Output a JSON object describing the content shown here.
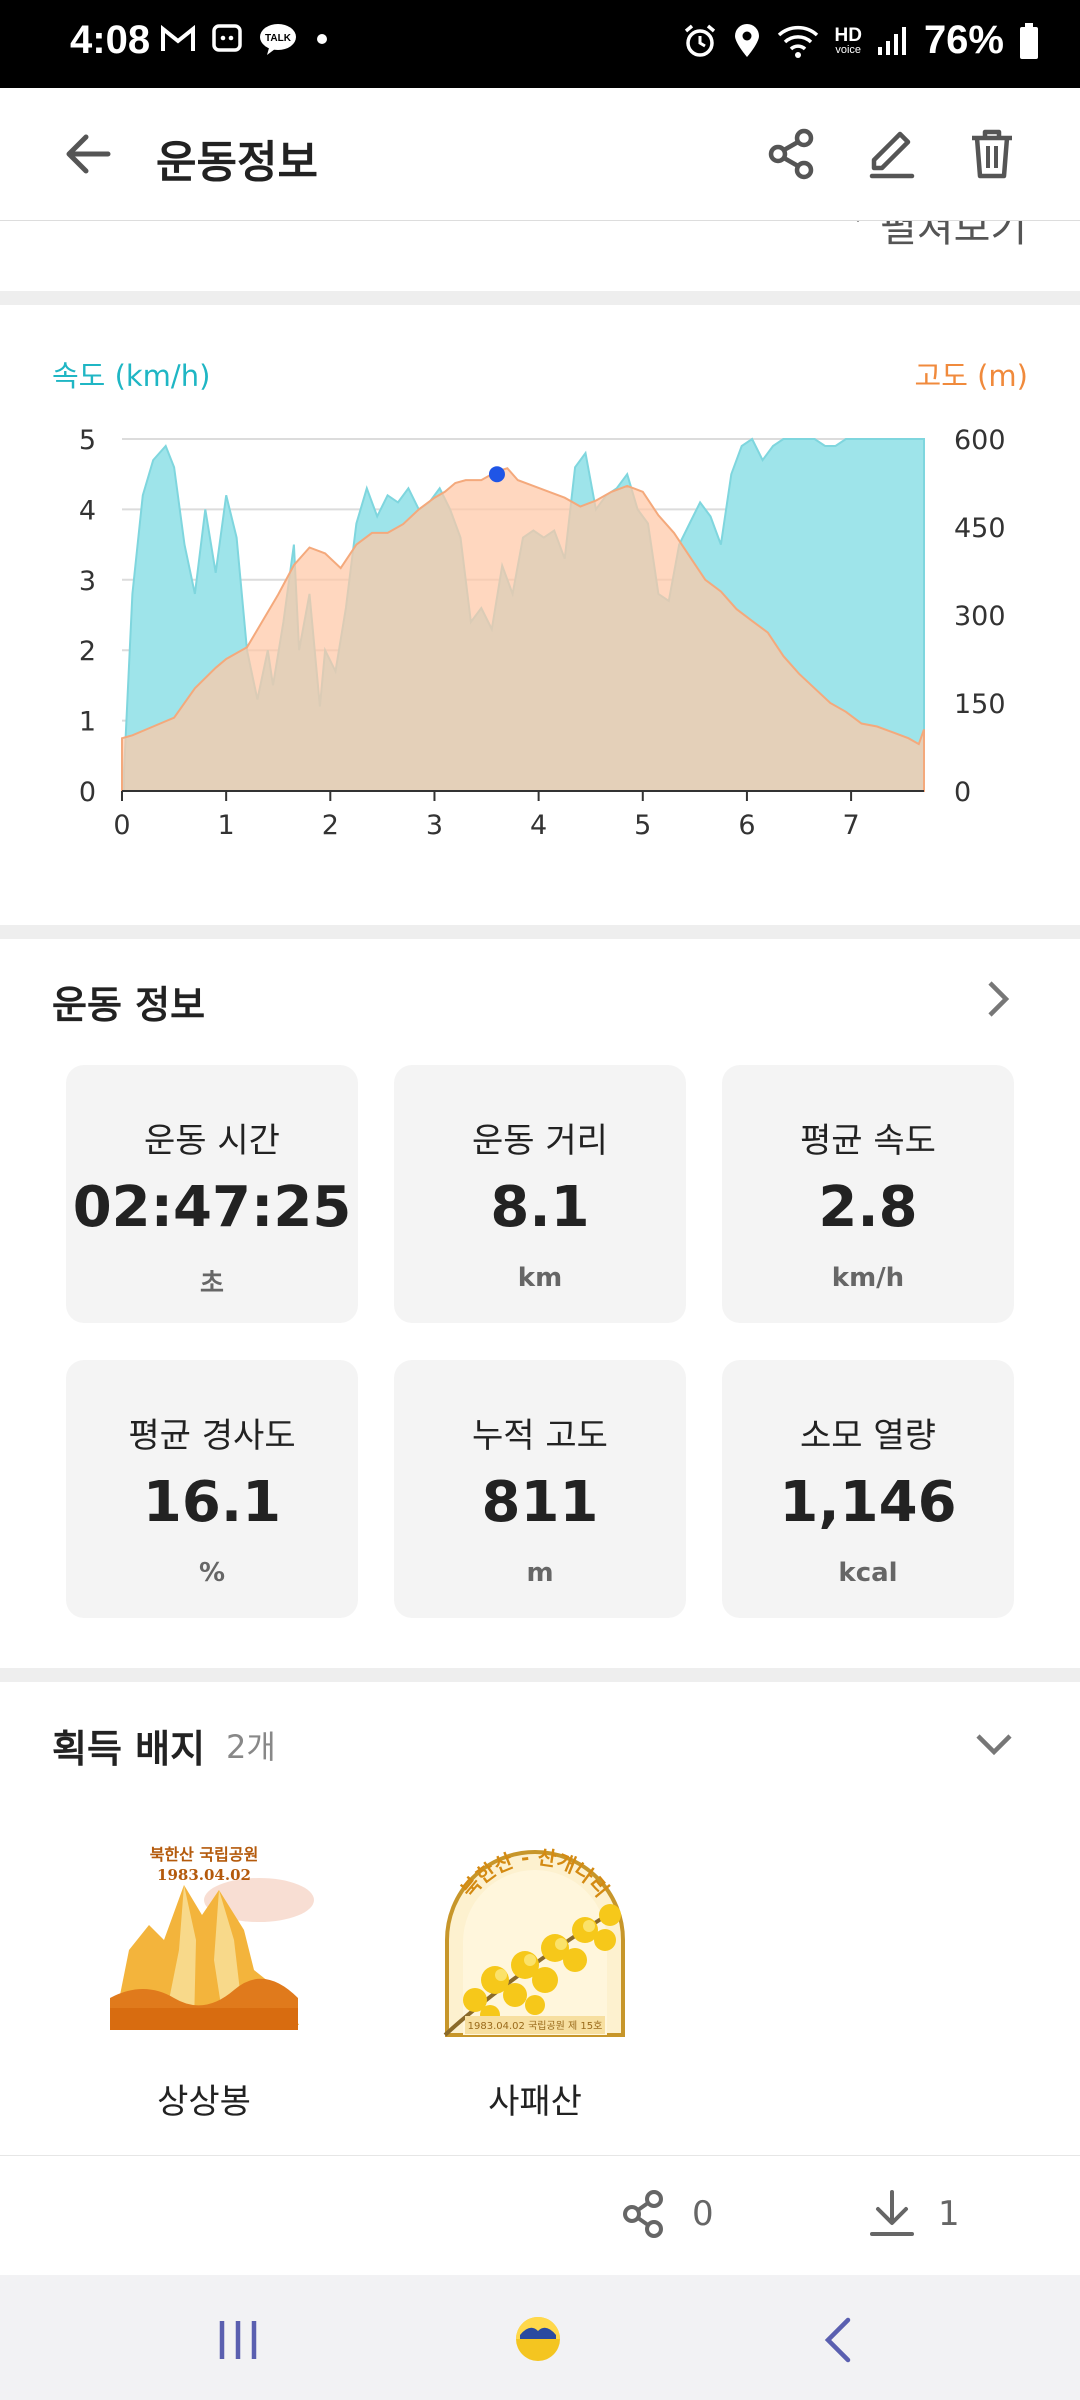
{
  "status_bar": {
    "time": "4:08",
    "left_icons": [
      "gmail-icon",
      "bixby-icon",
      "kakaotalk-icon",
      "dot-icon"
    ],
    "right_icons": [
      "alarm-icon",
      "location-icon",
      "wifi-icon",
      "hd-voice-icon",
      "signal-icon",
      "battery-icon"
    ],
    "hd_label": "HD",
    "voice_label": "voice",
    "battery": "76%"
  },
  "header": {
    "title": "운동정보"
  },
  "collapsed_section": {
    "label": "펼쳐보기"
  },
  "chart": {
    "legend_left": "속도 (km/h)",
    "legend_right": "고도 (m)"
  },
  "chart_data": {
    "type": "area",
    "xlabel": "",
    "ylabel_left": "속도 (km/h)",
    "ylabel_right": "고도 (m)",
    "x_ticks": [
      0,
      1,
      2,
      3,
      4,
      5,
      6,
      7
    ],
    "y_left_ticks": [
      0,
      1,
      2,
      3,
      4,
      5
    ],
    "y_right_ticks": [
      0,
      150,
      300,
      450,
      600
    ],
    "xlim": [
      0,
      7.7
    ],
    "ylim_left": [
      0,
      5
    ],
    "ylim_right": [
      0,
      600
    ],
    "grid": true,
    "marker": {
      "x": 3.6,
      "y_left": 4.5
    },
    "series": [
      {
        "name": "속도 (km/h)",
        "axis": "left",
        "color": "#9ee4ea",
        "x": [
          0.02,
          0.1,
          0.2,
          0.3,
          0.42,
          0.5,
          0.6,
          0.7,
          0.8,
          0.9,
          1.0,
          1.1,
          1.2,
          1.3,
          1.4,
          1.45,
          1.55,
          1.65,
          1.7,
          1.8,
          1.9,
          1.95,
          2.05,
          2.15,
          2.25,
          2.35,
          2.45,
          2.55,
          2.65,
          2.75,
          2.85,
          2.95,
          3.05,
          3.15,
          3.25,
          3.35,
          3.45,
          3.55,
          3.65,
          3.75,
          3.85,
          3.95,
          4.05,
          4.15,
          4.25,
          4.35,
          4.45,
          4.55,
          4.65,
          4.75,
          4.85,
          4.95,
          5.05,
          5.15,
          5.25,
          5.35,
          5.45,
          5.55,
          5.65,
          5.75,
          5.85,
          5.95,
          6.05,
          6.15,
          6.25,
          6.35,
          6.45,
          6.55,
          6.65,
          6.75,
          6.85,
          6.95,
          7.05,
          7.15,
          7.25,
          7.35,
          7.45,
          7.55,
          7.7
        ],
        "values": [
          0.3,
          2.8,
          4.2,
          4.7,
          4.9,
          4.6,
          3.5,
          2.8,
          4.0,
          3.1,
          4.2,
          3.6,
          2.0,
          1.3,
          2.0,
          1.5,
          2.4,
          3.5,
          2.0,
          2.8,
          1.2,
          2.0,
          1.7,
          2.6,
          3.8,
          4.3,
          3.9,
          4.2,
          4.1,
          4.3,
          4.0,
          4.1,
          4.3,
          4.0,
          3.6,
          2.4,
          2.6,
          2.3,
          3.2,
          2.8,
          3.6,
          3.7,
          3.6,
          3.7,
          3.3,
          4.6,
          4.8,
          4.0,
          4.2,
          4.3,
          4.5,
          4.0,
          3.8,
          2.8,
          2.7,
          3.5,
          3.8,
          4.1,
          3.9,
          3.5,
          4.5,
          4.9,
          5.0,
          4.7,
          4.9,
          5.0,
          5.0,
          5.0,
          5.0,
          4.9,
          4.9,
          5.0,
          5.0,
          5.0,
          5.0,
          5.0,
          5.0,
          5.0,
          5.0
        ]
      },
      {
        "name": "고도 (m)",
        "axis": "right",
        "color": "#ffc7a6",
        "x": [
          0.0,
          0.1,
          0.3,
          0.5,
          0.7,
          0.9,
          1.0,
          1.2,
          1.35,
          1.5,
          1.65,
          1.8,
          1.95,
          2.1,
          2.25,
          2.4,
          2.55,
          2.7,
          2.85,
          3.0,
          3.1,
          3.2,
          3.3,
          3.45,
          3.6,
          3.7,
          3.8,
          3.95,
          4.1,
          4.25,
          4.4,
          4.55,
          4.7,
          4.85,
          5.0,
          5.15,
          5.3,
          5.45,
          5.6,
          5.75,
          5.9,
          6.05,
          6.2,
          6.35,
          6.5,
          6.65,
          6.8,
          6.95,
          7.1,
          7.25,
          7.4,
          7.55,
          7.65,
          7.7
        ],
        "values": [
          90,
          95,
          110,
          125,
          175,
          210,
          225,
          245,
          290,
          335,
          385,
          415,
          405,
          380,
          420,
          440,
          440,
          455,
          480,
          500,
          510,
          525,
          530,
          530,
          545,
          550,
          530,
          520,
          510,
          500,
          485,
          495,
          510,
          520,
          510,
          470,
          440,
          400,
          360,
          340,
          310,
          290,
          270,
          230,
          200,
          175,
          150,
          135,
          115,
          110,
          100,
          90,
          80,
          105
        ]
      }
    ]
  },
  "exercise_section": {
    "title": "운동 정보",
    "stats": [
      {
        "label": "운동 시간",
        "value": "02:47:25",
        "unit": "초"
      },
      {
        "label": "운동 거리",
        "value": "8.1",
        "unit": "km"
      },
      {
        "label": "평균 속도",
        "value": "2.8",
        "unit": "km/h"
      },
      {
        "label": "평균 경사도",
        "value": "16.1",
        "unit": "%"
      },
      {
        "label": "누적 고도",
        "value": "811",
        "unit": "m"
      },
      {
        "label": "소모 열량",
        "value": "1,146",
        "unit": "kcal"
      }
    ]
  },
  "badges_section": {
    "title": "획득 배지",
    "count": "2개",
    "badges": [
      {
        "name": "상상봉",
        "text_line1": "북한산 국립공원",
        "text_line2": "1983.04.02"
      },
      {
        "name": "사패산",
        "text_arc": "북한산 - 산개나리",
        "text_bottom": "1983.04.02 국립공원 제 15호"
      }
    ]
  },
  "footer": {
    "share_count": "0",
    "download_count": "1"
  },
  "nav": {
    "icons": [
      "recent-apps-icon",
      "home-icon",
      "back-nav-icon"
    ]
  },
  "colors": {
    "speed": "#1fb6c4",
    "altitude": "#f08a3c",
    "marker": "#1f55e6"
  }
}
